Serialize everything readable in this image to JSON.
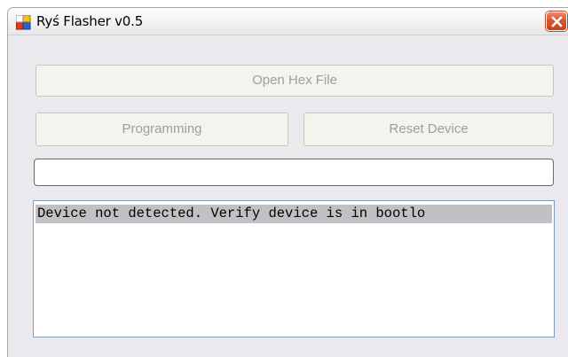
{
  "window": {
    "title": "Ryś Flasher v0.5",
    "icon": "app-window-icon",
    "close_icon": "close-icon"
  },
  "buttons": {
    "open_hex": "Open Hex File",
    "programming": "Programming",
    "reset_device": "Reset Device"
  },
  "progress": {
    "value": 0
  },
  "log": {
    "lines": [
      "Device not detected. Verify device is in bootlo"
    ]
  },
  "colors": {
    "window_bg": "#ebe9ed",
    "disabled_text": "#a19f94",
    "close_button": "#d8582f",
    "selection_bg": "#c1c0c5"
  }
}
